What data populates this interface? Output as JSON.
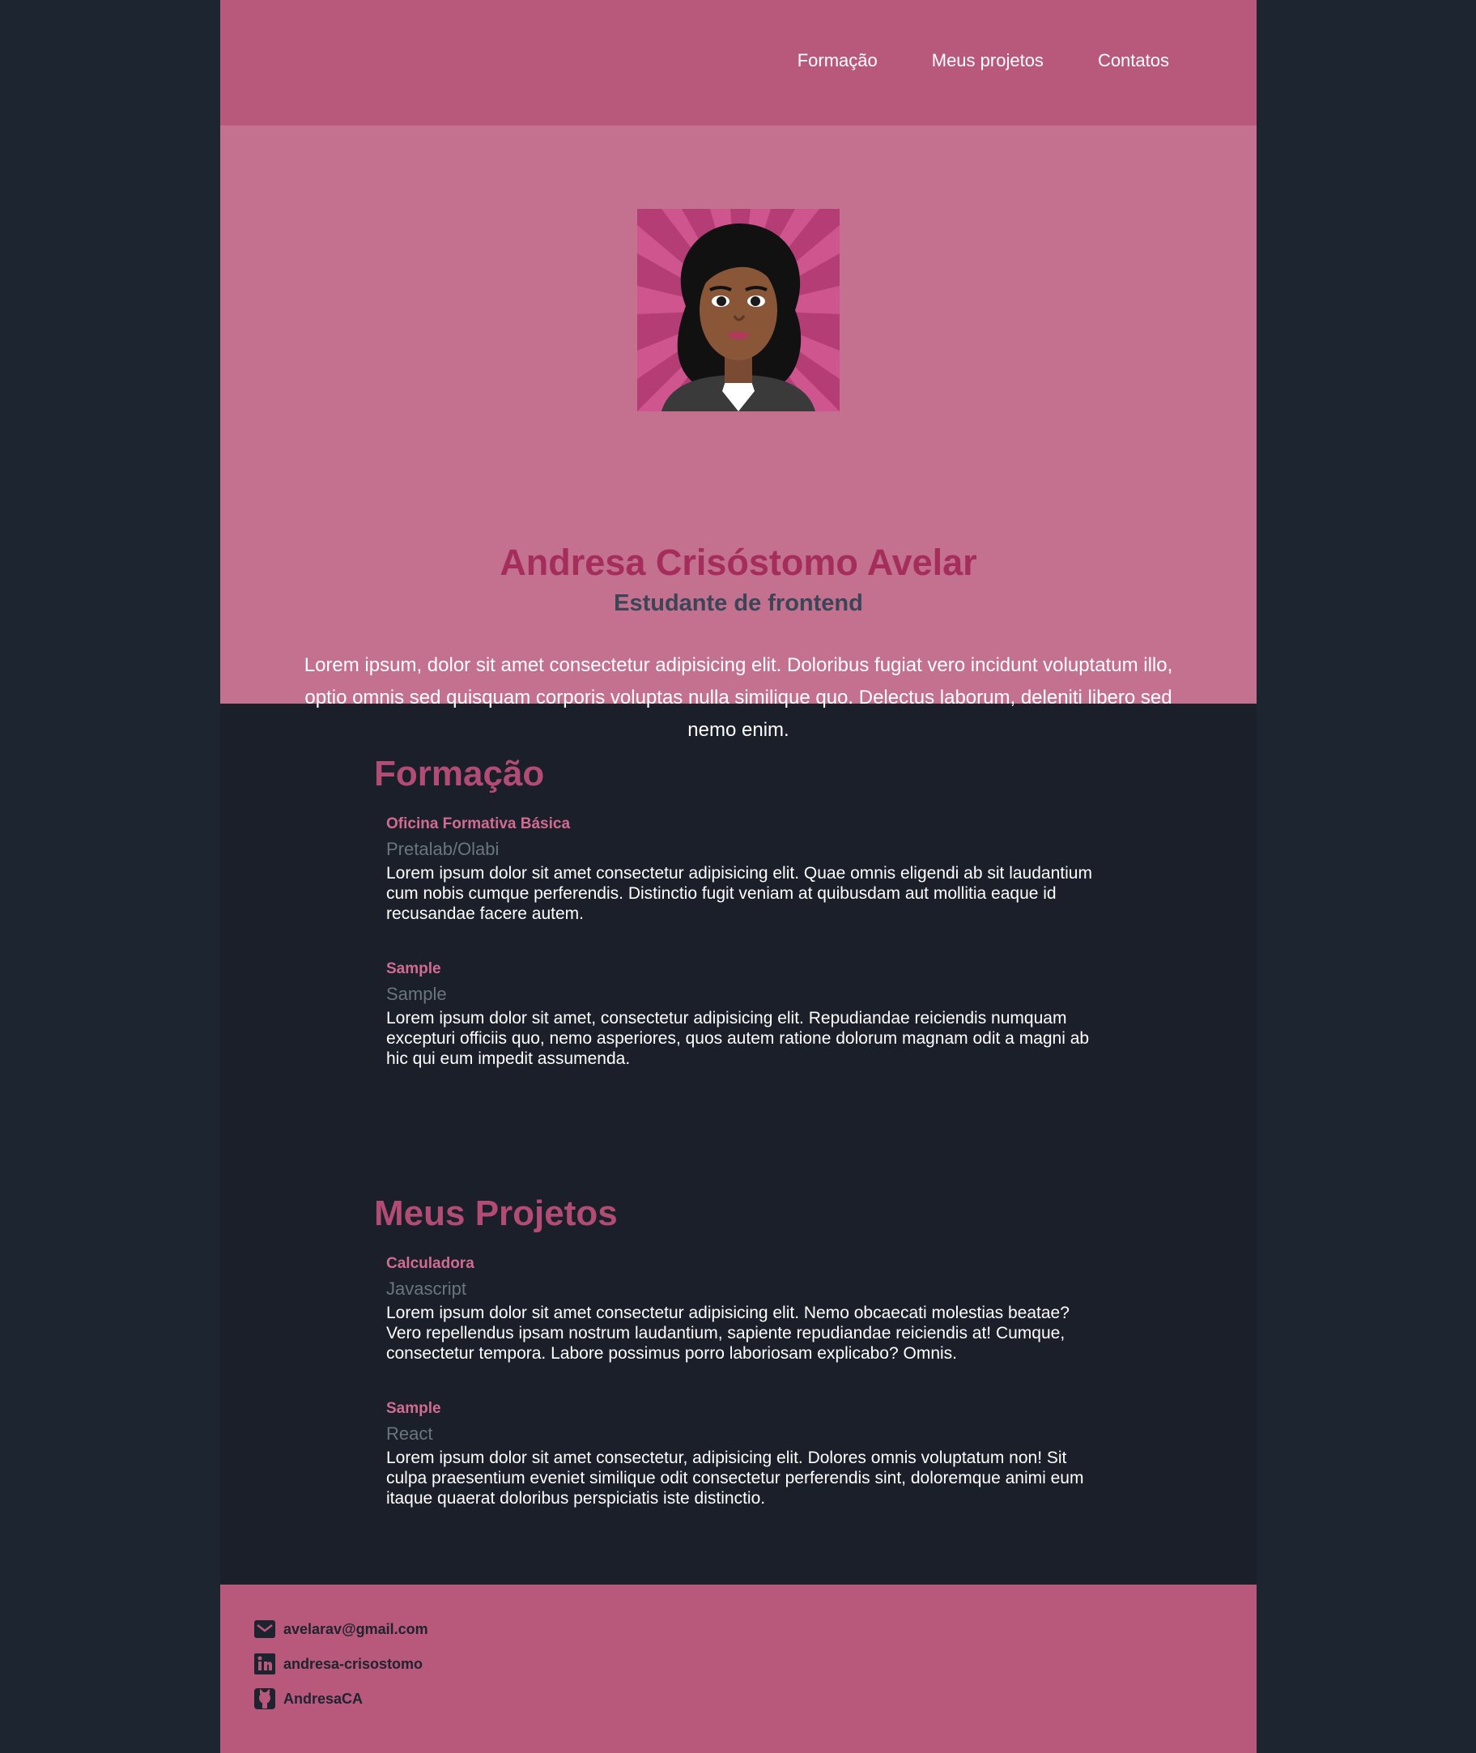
{
  "nav": {
    "items": [
      "Formação",
      "Meus projetos",
      "Contatos"
    ]
  },
  "hero": {
    "name": "Andresa Crisóstomo Avelar",
    "subtitle": "Estudante de frontend",
    "description": "Lorem ipsum, dolor sit amet consectetur adipisicing elit. Doloribus fugiat vero incidunt voluptatum illo, optio omnis sed quisquam corporis voluptas nulla similique quo. Delectus laborum, deleniti libero sed nemo enim."
  },
  "formacao": {
    "title": "Formação",
    "entries": [
      {
        "title": "Oficina Formativa Básica",
        "subtitle": "Pretalab/Olabi",
        "description": "Lorem ipsum dolor sit amet consectetur adipisicing elit. Quae omnis eligendi ab sit laudantium cum nobis cumque perferendis. Distinctio fugit veniam at quibusdam aut mollitia eaque id recusandae facere autem."
      },
      {
        "title": "Sample",
        "subtitle": "Sample",
        "description": "Lorem ipsum dolor sit amet, consectetur adipisicing elit. Repudiandae reiciendis numquam excepturi officiis quo, nemo asperiores, quos autem ratione dolorum magnam odit a magni ab hic qui eum impedit assumenda."
      }
    ]
  },
  "projetos": {
    "title": "Meus Projetos",
    "entries": [
      {
        "title": "Calculadora",
        "subtitle": "Javascript",
        "description": "Lorem ipsum dolor sit amet consectetur adipisicing elit. Nemo obcaecati molestias beatae? Vero repellendus ipsam nostrum laudantium, sapiente repudiandae reiciendis at! Cumque, consectetur tempora. Labore possimus porro laboriosam explicabo? Omnis."
      },
      {
        "title": "Sample",
        "subtitle": "React",
        "description": "Lorem ipsum dolor sit amet consectetur, adipisicing elit. Dolores omnis voluptatum non! Sit culpa praesentium eveniet similique odit consectetur perferendis sint, doloremque animi eum itaque quaerat doloribus perspiciatis iste distinctio."
      }
    ]
  },
  "footer": {
    "email": "avelarav@gmail.com",
    "linkedin": "andresa-crisostomo",
    "github": "AndresaCA"
  },
  "colors": {
    "header": "#b8587b",
    "hero": "#c3718f",
    "accent": "#a52d5c",
    "background": "#1a1f29"
  },
  "icons": [
    "envelope-icon",
    "linkedin-icon",
    "github-icon"
  ]
}
